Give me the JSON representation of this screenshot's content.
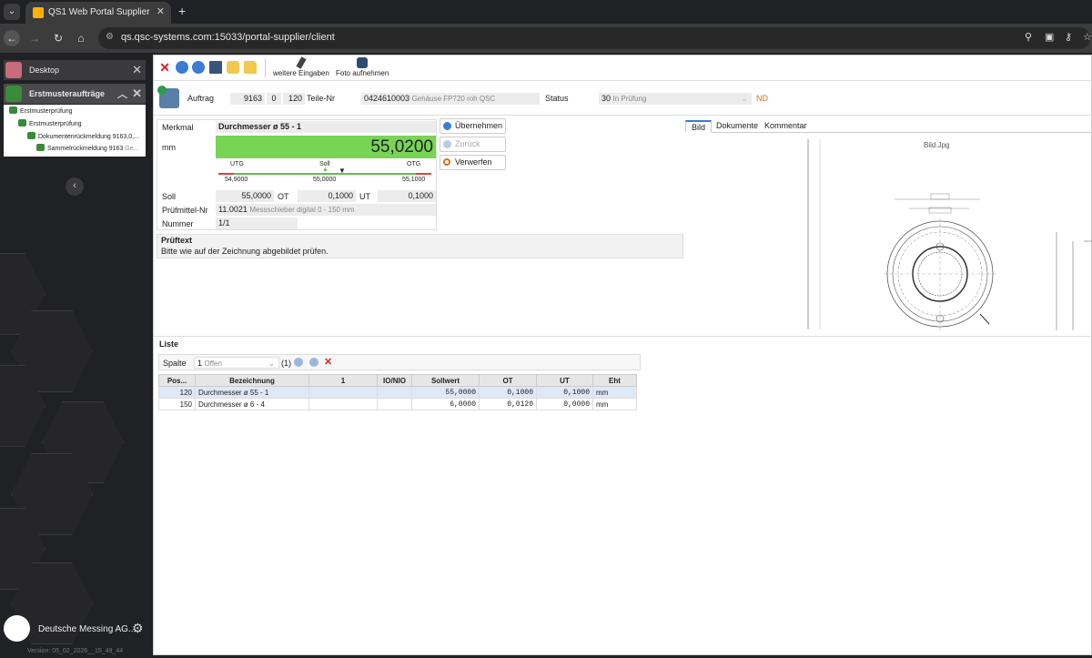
{
  "browser": {
    "tab_title": "QS1 Web Portal Supplier",
    "tab_close": "✕",
    "new_tab": "+",
    "url": "qs.qsc-systems.com:15033/portal-supplier/client"
  },
  "sidebar": {
    "desktop_label": "Desktop",
    "module_label": "Erstmusteraufträge",
    "tree": [
      "Erstmusterprüfung",
      "Erstmusterprüfung",
      "Dokumentenrückmeldung 9163,0,...",
      "Sammelrückmeldung 9163"
    ],
    "tree_suffix": "Ge...",
    "user_name": "Deutsche Messing AG...",
    "version": "Version: 05_02_2026__15_49_44"
  },
  "toolbar": {
    "weitere_label": "weitere Eingaben",
    "foto_label": "Foto aufnehmen"
  },
  "header": {
    "auftrag_label": "Auftrag",
    "auftrag_nr": "9163",
    "auftrag_pos": "0",
    "auftrag_sub": "120",
    "teile_label": "Teile-Nr",
    "teile_nr": "0424610003",
    "teile_desc": "Gehäuse FP720 roh QSC",
    "status_label": "Status",
    "status_code": "30",
    "status_text": "In Prüfung",
    "status_flag": "ND"
  },
  "measure": {
    "merkmal_label": "Merkmal",
    "merkmal_value": "Durchmesser ø 55 - 1",
    "unit": "mm",
    "value": "55,0200",
    "utg_label": "UTG",
    "soll_mark_label": "Soll",
    "otg_label": "OTG",
    "utg_value": "54,9000",
    "soll_mark_value": "55,0000",
    "otg_value": "55,1000",
    "soll_label": "Soll",
    "soll_value": "55,0000",
    "ot_label": "OT",
    "ot_value": "0,1000",
    "ut_label": "UT",
    "ut_value": "0,1000",
    "pruefmittel_label": "Prüfmittel-Nr",
    "pruefmittel_nr": "11.0021",
    "pruefmittel_desc": "Messschieber digital 0 - 150 mm",
    "nummer_label": "Nummer",
    "nummer_value": "1/1"
  },
  "actions": {
    "uebernehmen": "Übernehmen",
    "zurueck": "Zurück",
    "verwerfen": "Verwerfen"
  },
  "pruef": {
    "title": "Prüftext",
    "text": "Bitte wie auf der Zeichnung abgebildet prüfen."
  },
  "right_tabs": {
    "bild": "Bild",
    "dokumente": "Dokumente",
    "kommentar": "Kommentar",
    "image_name": "Bild.Jpg"
  },
  "liste": {
    "title": "Liste",
    "spalte_label": "Spalte",
    "filter_value": "1",
    "filter_text": "Offen",
    "count": "(1)",
    "columns": [
      "Pos...",
      "Bezeichnung",
      "1",
      "IO/NIO",
      "Sollwert",
      "OT",
      "UT",
      "Eht"
    ],
    "rows": [
      {
        "pos": "120",
        "bez": "Durchmesser ø 55 - 1",
        "v1": "",
        "io": "",
        "soll": "55,0000",
        "ot": "0,1000",
        "ut": "0,1000",
        "eht": "mm"
      },
      {
        "pos": "150",
        "bez": "Durchmesser ø 6 - 4",
        "v1": "",
        "io": "",
        "soll": "6,0000",
        "ot": "0,0120",
        "ut": "0,0000",
        "eht": "mm"
      }
    ]
  },
  "colors": {
    "accent": "#3a7bd5",
    "in_tolerance": "#78d455",
    "status_flag": "#e06c1a",
    "selected_row": "#dfe8f6"
  }
}
